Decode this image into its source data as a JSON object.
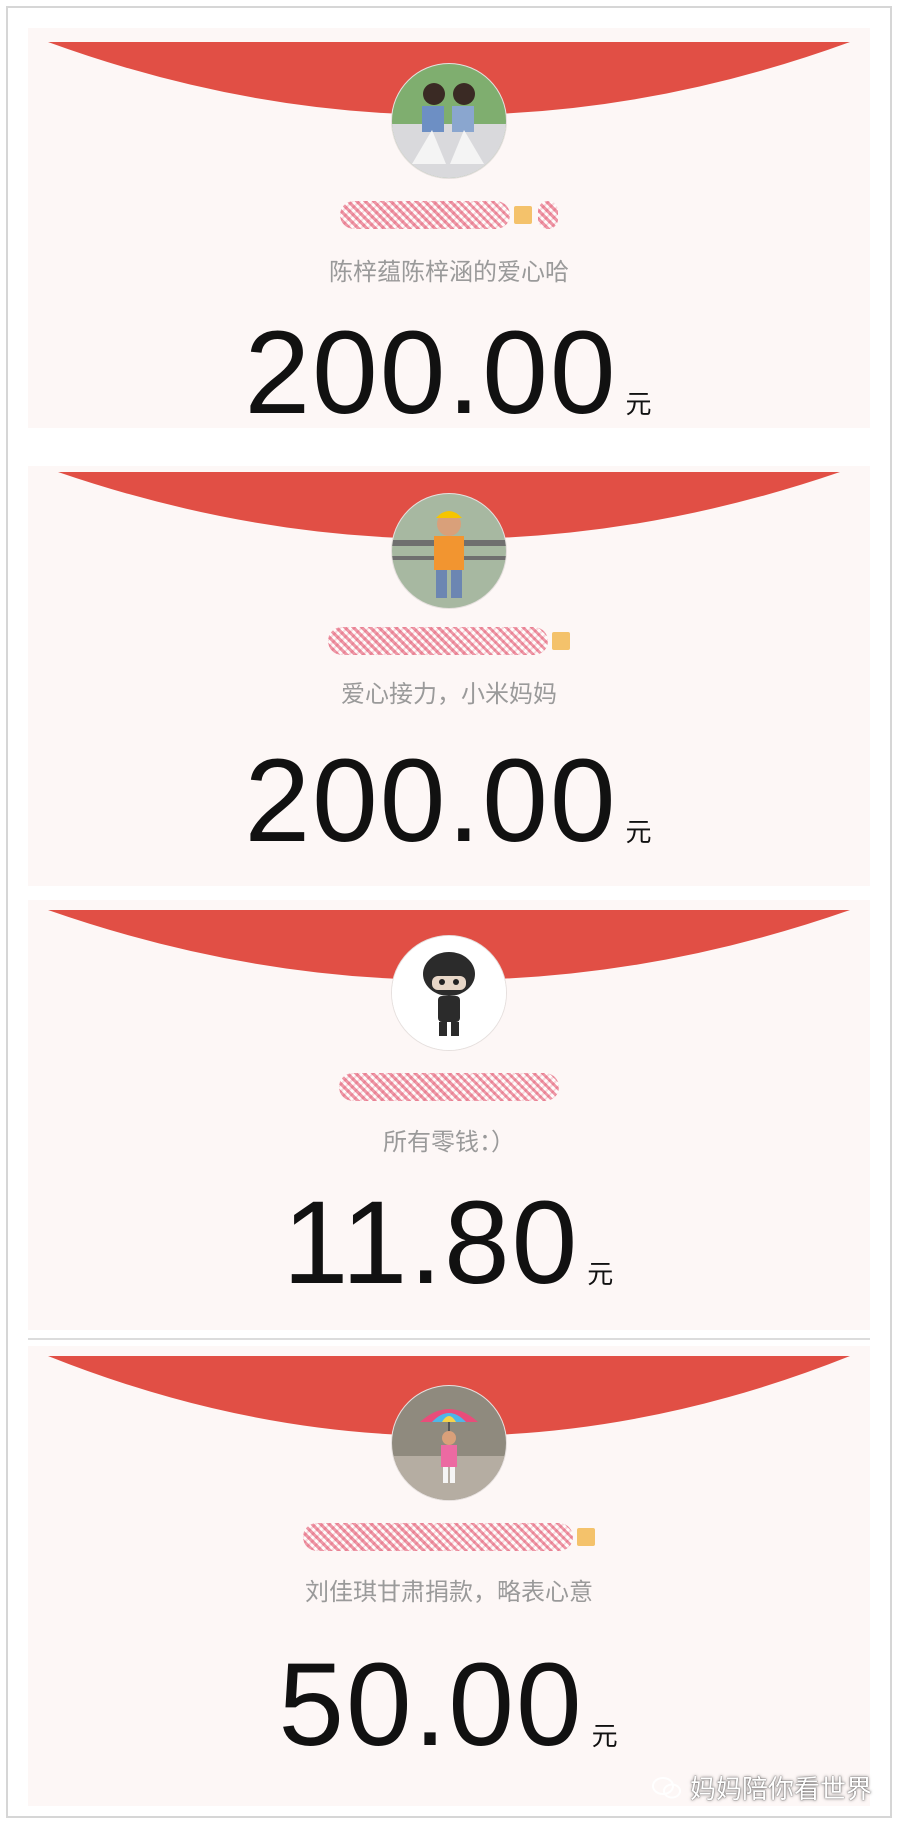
{
  "colors": {
    "envelope_red": "#e14f45",
    "card_bg": "#fdf7f6",
    "greeting_gray": "#9a9a9a"
  },
  "envelopes": [
    {
      "greeting": "陈梓蕴陈梓涵的爱心哈",
      "amount": "200.00",
      "unit": "元",
      "avatar": "twin-children-photo"
    },
    {
      "greeting": "爱心接力，小米妈妈",
      "amount": "200.00",
      "unit": "元",
      "avatar": "boy-yellow-cap-photo"
    },
    {
      "greeting": "所有零钱：）",
      "amount": "11.80",
      "unit": "元",
      "avatar": "cartoon-helmet-figure"
    },
    {
      "greeting": "刘佳琪甘肃捐款，略表心意",
      "amount": "50.00",
      "unit": "元",
      "avatar": "girl-rainbow-umbrella-photo"
    }
  ],
  "watermark": {
    "text": "妈妈陪你看世界",
    "icon": "wechat-icon"
  }
}
